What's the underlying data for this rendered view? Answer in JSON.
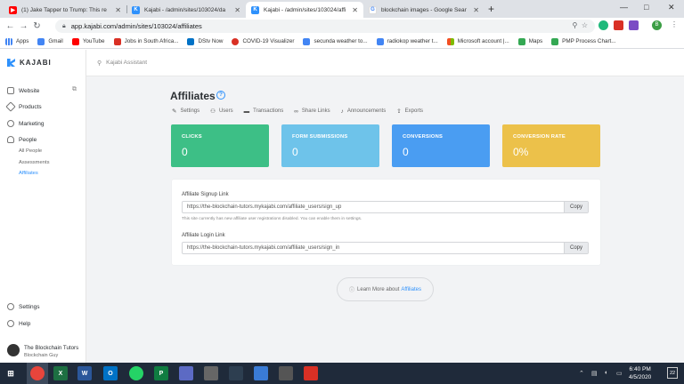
{
  "browser": {
    "tabs": [
      {
        "title": "(1) Jake Tapper to Trump: This re",
        "icon": "youtube-icon",
        "color": "#ff0000"
      },
      {
        "title": "Kajabi - /admin/sites/103024/da",
        "icon": "kajabi-icon",
        "color": "#2e91fc"
      },
      {
        "title": "Kajabi - /admin/sites/103024/affi",
        "icon": "kajabi-icon",
        "color": "#2e91fc"
      },
      {
        "title": "blockchain images - Google Sear",
        "icon": "google-icon",
        "color": "#4285f4"
      }
    ],
    "new_tab": "+",
    "window_controls": {
      "minimize": "—",
      "maximize": "□",
      "close": "✕"
    },
    "url": "app.kajabi.com/admin/sites/103024/affiliates",
    "profile_initial": "B",
    "bookmarks": [
      {
        "label": "Apps",
        "color": "#e8453c"
      },
      {
        "label": "Gmail",
        "color": "#4285f4"
      },
      {
        "label": "YouTube",
        "color": "#ff0000"
      },
      {
        "label": "Jobs in South Africa...",
        "color": "#d93025"
      },
      {
        "label": "DStv Now",
        "color": "#0072c6"
      },
      {
        "label": "COVID-19 Visualizer",
        "color": "#d93025"
      },
      {
        "label": "secunda weather to...",
        "color": "#4285f4"
      },
      {
        "label": "radiokop weather t...",
        "color": "#4285f4"
      },
      {
        "label": "Microsoft account |...",
        "color": "#f25022"
      },
      {
        "label": "Maps",
        "color": "#34a853"
      },
      {
        "label": "PMP Process Chart...",
        "color": "#34a853"
      }
    ]
  },
  "sidebar": {
    "logo": "KAJABI",
    "items": [
      {
        "label": "Website"
      },
      {
        "label": "Products"
      },
      {
        "label": "Marketing"
      },
      {
        "label": "People"
      }
    ],
    "sub_items": [
      {
        "label": "All People"
      },
      {
        "label": "Assessments"
      },
      {
        "label": "Affiliates"
      }
    ],
    "bottom_items": [
      {
        "label": "Settings"
      },
      {
        "label": "Help"
      }
    ],
    "user": {
      "name": "The Blockchain Tutors",
      "role": "Blockchain Guy"
    }
  },
  "assistant": {
    "placeholder": "Kajabi Assistant"
  },
  "page": {
    "title": "Affiliates",
    "subnav": [
      {
        "label": "Settings",
        "icon": "pencil-icon"
      },
      {
        "label": "Users",
        "icon": "users-icon"
      },
      {
        "label": "Transactions",
        "icon": "card-icon"
      },
      {
        "label": "Share Links",
        "icon": "link-icon"
      },
      {
        "label": "Announcements",
        "icon": "bell-icon"
      },
      {
        "label": "Exports",
        "icon": "upload-icon"
      }
    ],
    "stats": [
      {
        "label": "CLICKS",
        "value": "0",
        "color": "#3dbf86"
      },
      {
        "label": "FORM SUBMISSIONS",
        "value": "0",
        "color": "#6ec3ea"
      },
      {
        "label": "CONVERSIONS",
        "value": "0",
        "color": "#4a9df2"
      },
      {
        "label": "CONVERSION RATE",
        "value": "0%",
        "color": "#ecc14a"
      }
    ],
    "signup": {
      "label": "Affiliate Signup Link",
      "url": "https://the-blockchain-tutors.mykajabi.com/affiliate_users/sign_up",
      "copy": "Copy",
      "note": "This site currently has new affiliate user registrations disabled. You can enable them in settings."
    },
    "login": {
      "label": "Affiliate Login Link",
      "url": "https://the-blockchain-tutors.mykajabi.com/affiliate_users/sign_in",
      "copy": "Copy"
    },
    "learn_more": {
      "text": "Learn More about",
      "link": "Affiliates"
    }
  },
  "taskbar": {
    "time": "6:40 PM",
    "date": "4/5/2020",
    "notification_count": "22"
  }
}
